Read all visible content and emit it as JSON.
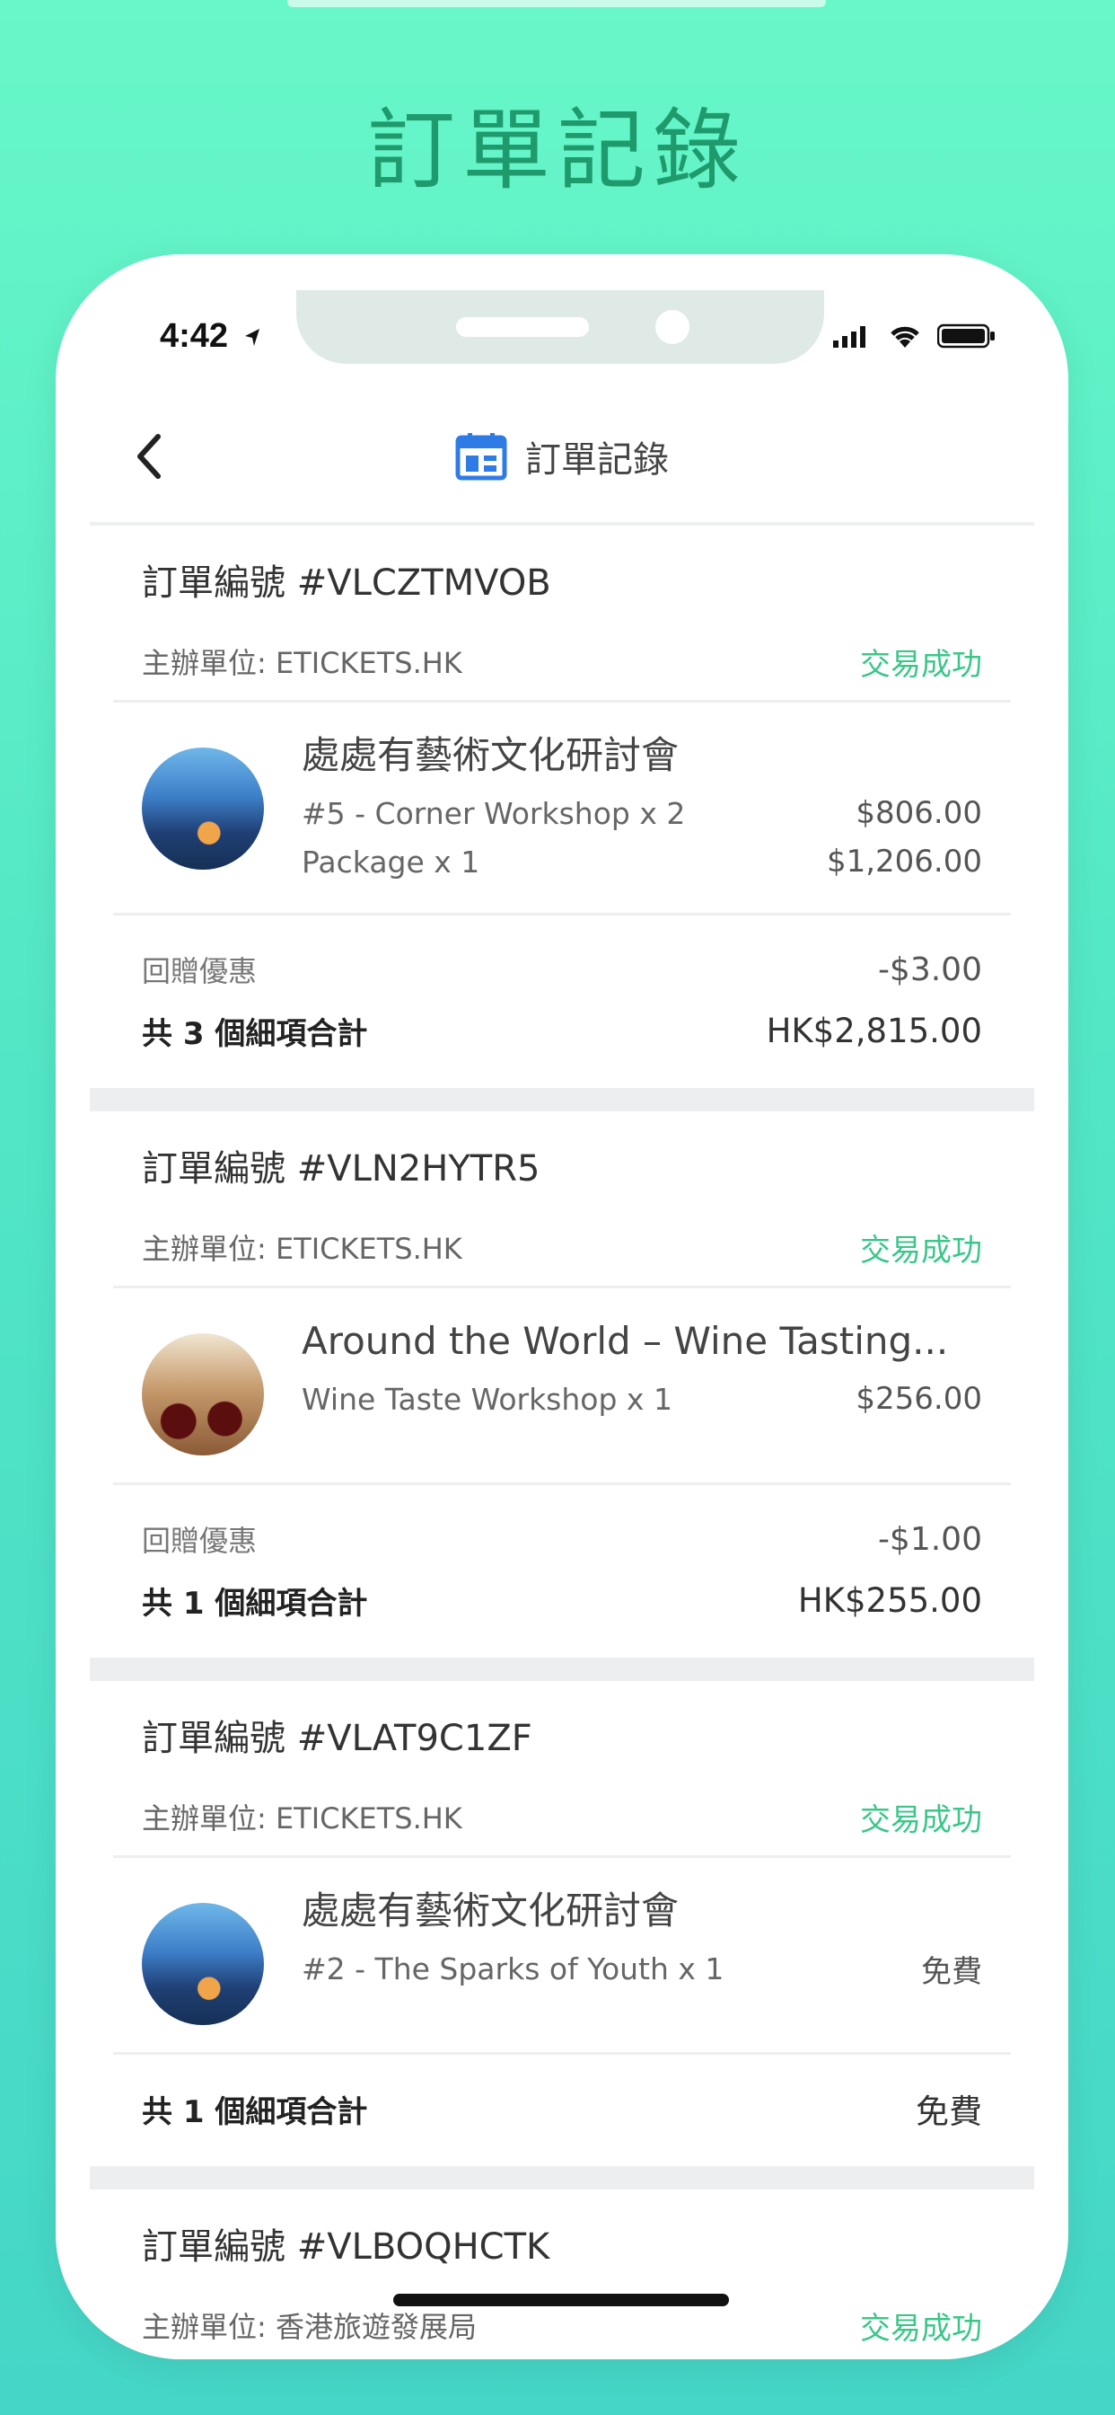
{
  "marketing_title": "訂單記錄",
  "status_bar": {
    "time": "4:42"
  },
  "nav": {
    "title": "訂單記錄",
    "back_icon": "chevron-left-icon",
    "title_icon": "calendar-icon",
    "accent_color": "#2f7be5"
  },
  "colors": {
    "success": "#3cc68a",
    "separator": "#eceeef"
  },
  "orders": [
    {
      "order_no": "訂單編號 #VLCZTMVOB",
      "organizer": "主辦單位: ETICKETS.HK",
      "status": "交易成功",
      "event_title": "處處有藝術文化研討會",
      "lines": [
        {
          "name": "#5 - Corner Workshop x 2",
          "price": "$806.00"
        },
        {
          "name": "Package x 1",
          "price": "$1,206.00"
        }
      ],
      "discount_label": "回贈優惠",
      "discount_value": "-$3.00",
      "total_label": "共 3 個細項合計",
      "total_value": "HK$2,815.00"
    },
    {
      "order_no": "訂單編號 #VLN2HYTR5",
      "organizer": "主辦單位: ETICKETS.HK",
      "status": "交易成功",
      "event_title": "Around the World – Wine Tasting...",
      "lines": [
        {
          "name": "Wine Taste Workshop x 1",
          "price": "$256.00"
        }
      ],
      "discount_label": "回贈優惠",
      "discount_value": "-$1.00",
      "total_label": "共 1 個細項合計",
      "total_value": "HK$255.00"
    },
    {
      "order_no": "訂單編號 #VLAT9C1ZF",
      "organizer": "主辦單位: ETICKETS.HK",
      "status": "交易成功",
      "event_title": "處處有藝術文化研討會",
      "lines": [
        {
          "name": "#2 - The Sparks of Youth x 1",
          "price": "免費"
        }
      ],
      "total_label": "共 1 個細項合計",
      "total_value": "免費"
    },
    {
      "order_no": "訂單編號 #VLBOQHCTK",
      "organizer": "主辦單位: 香港旅遊發展局",
      "status": "交易成功"
    }
  ]
}
